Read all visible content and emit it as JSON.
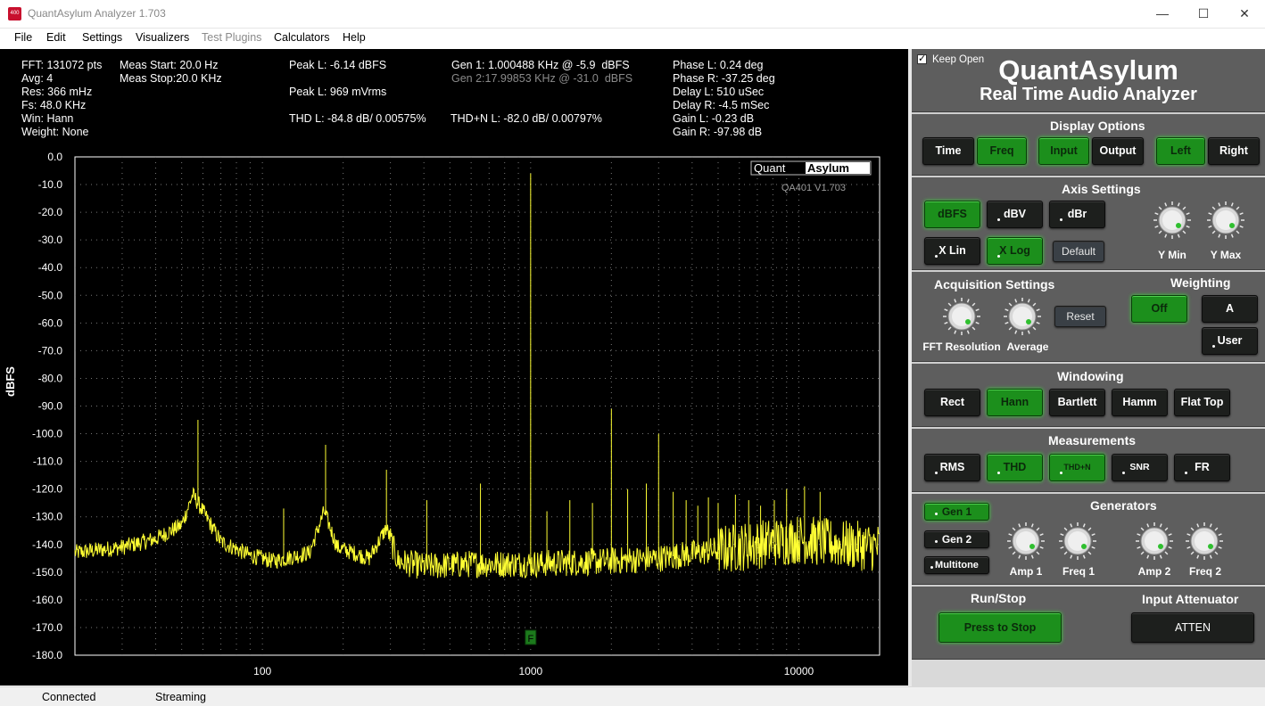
{
  "window": {
    "title": "QuantAsylum Analyzer 1.703",
    "icon_text": "400",
    "minimize": "—",
    "maximize": "☐",
    "close": "✕"
  },
  "menu": [
    "File",
    "Edit",
    "Settings",
    "Visualizers",
    "Test Plugins",
    "Calculators",
    "Help"
  ],
  "stats": {
    "fft": "FFT: 131072 pts",
    "avg": "Avg: 4",
    "res": "Res: 366 mHz",
    "fs": "Fs: 48.0 KHz",
    "win": "Win: Hann",
    "weight": "Weight: None",
    "meas_start": "Meas Start: 20.0 Hz",
    "meas_stop": "Meas Stop:20.0 KHz",
    "peak_l_dbfs": "Peak L: -6.14 dBFS",
    "peak_l_vrms": "Peak L: 969 mVrms",
    "thd_l": "THD L: -84.8 dB/ 0.00575%",
    "gen1": "Gen 1: 1.000488 KHz @ -5.9  dBFS",
    "gen2": "Gen 2:17.99853 KHz @ -31.0  dBFS",
    "thdn_l": "THD+N L: -82.0 dB/ 0.00797%",
    "phase_l": "Phase L: 0.24 deg",
    "phase_r": "Phase R: -37.25 deg",
    "delay_l": "Delay L: 510 uSec",
    "delay_r": "Delay R: -4.5 mSec",
    "gain_l": "Gain L: -0.23 dB",
    "gain_r": "Gain R: -97.98 dB"
  },
  "chart_data": {
    "type": "line",
    "ylabel": "dBFS",
    "xlabel": "",
    "xscale": "log",
    "xlim": [
      20,
      20000
    ],
    "ylim": [
      -180,
      0
    ],
    "yticks": [
      "0.0",
      "-10.0",
      "-20.0",
      "-30.0",
      "-40.0",
      "-50.0",
      "-60.0",
      "-70.0",
      "-80.0",
      "-90.0",
      "-100.0",
      "-110.0",
      "-120.0",
      "-130.0",
      "-140.0",
      "-150.0",
      "-160.0",
      "-170.0",
      "-180.0"
    ],
    "xticks": [
      {
        "value": 100,
        "label": "100"
      },
      {
        "value": 1000,
        "label": "1000"
      },
      {
        "value": 10000,
        "label": "10000"
      }
    ],
    "grid": true,
    "watermark_brand_a": "Quant",
    "watermark_brand_b": "Asylum",
    "watermark_version": "QA401 V1.703",
    "marker_label": "F",
    "marker_x": 1000,
    "series_color": "#ffff33",
    "noise_floor": [
      [
        20,
        -143
      ],
      [
        30,
        -141
      ],
      [
        40,
        -138
      ],
      [
        50,
        -133
      ],
      [
        55,
        -122
      ],
      [
        60,
        -128
      ],
      [
        70,
        -139
      ],
      [
        90,
        -144
      ],
      [
        110,
        -146
      ],
      [
        150,
        -143
      ],
      [
        170,
        -128
      ],
      [
        190,
        -141
      ],
      [
        250,
        -145
      ],
      [
        290,
        -134
      ],
      [
        320,
        -146
      ],
      [
        400,
        -148
      ],
      [
        600,
        -147
      ],
      [
        1000,
        -147
      ],
      [
        2000,
        -146
      ],
      [
        3000,
        -145
      ],
      [
        5000,
        -142
      ],
      [
        7000,
        -140
      ],
      [
        10000,
        -138
      ],
      [
        14000,
        -140
      ],
      [
        20000,
        -141
      ]
    ],
    "peaks": [
      {
        "x": 57.5,
        "y": -95
      },
      {
        "x": 120,
        "y": -127
      },
      {
        "x": 172,
        "y": -104
      },
      {
        "x": 290,
        "y": -113
      },
      {
        "x": 410,
        "y": -124
      },
      {
        "x": 650,
        "y": -118
      },
      {
        "x": 1000,
        "y": -6
      },
      {
        "x": 1150,
        "y": -128
      },
      {
        "x": 1400,
        "y": -124
      },
      {
        "x": 1700,
        "y": -125
      },
      {
        "x": 2000,
        "y": -91
      },
      {
        "x": 2300,
        "y": -120
      },
      {
        "x": 2700,
        "y": -118
      },
      {
        "x": 3000,
        "y": -100
      },
      {
        "x": 3400,
        "y": -121
      },
      {
        "x": 3800,
        "y": -124
      },
      {
        "x": 4200,
        "y": -126
      },
      {
        "x": 4600,
        "y": -123
      },
      {
        "x": 5000,
        "y": -125
      },
      {
        "x": 5800,
        "y": -122
      },
      {
        "x": 6500,
        "y": -124
      },
      {
        "x": 7200,
        "y": -126
      },
      {
        "x": 8100,
        "y": -124
      },
      {
        "x": 9000,
        "y": -120
      },
      {
        "x": 10500,
        "y": -119
      },
      {
        "x": 12000,
        "y": -121
      }
    ]
  },
  "panel": {
    "keep_open": "Keep Open",
    "brand_title": "QuantAsylum",
    "brand_sub": "Real Time Audio Analyzer",
    "display_options": {
      "title": "Display Options",
      "time": "Time",
      "freq": "Freq",
      "input": "Input",
      "output": "Output",
      "left": "Left",
      "right": "Right"
    },
    "axis_settings": {
      "title": "Axis Settings",
      "dbfs": "dBFS",
      "dbv": "dBV",
      "dbr": "dBr",
      "xlin": "X Lin",
      "xlog": "X Log",
      "default": "Default",
      "ymin": "Y Min",
      "ymax": "Y Max"
    },
    "acquisition": {
      "title": "Acquisition Settings",
      "reset": "Reset",
      "fft_res": "FFT Resolution",
      "average": "Average"
    },
    "weighting": {
      "title": "Weighting",
      "off": "Off",
      "a": "A",
      "user": "User"
    },
    "windowing": {
      "title": "Windowing",
      "rect": "Rect",
      "hann": "Hann",
      "bartlett": "Bartlett",
      "hamm": "Hamm",
      "flattop": "Flat Top"
    },
    "measurements": {
      "title": "Measurements",
      "rms": "RMS",
      "thd": "THD",
      "thdn": "THD+N",
      "snr": "SNR",
      "fr": "FR"
    },
    "generators": {
      "title": "Generators",
      "gen1": "Gen 1",
      "gen2": "Gen 2",
      "multitone": "Multitone",
      "amp1": "Amp 1",
      "freq1": "Freq 1",
      "amp2": "Amp 2",
      "freq2": "Freq 2"
    },
    "runstop": {
      "title": "Run/Stop",
      "button": "Press to Stop"
    },
    "attenuator": {
      "title": "Input Attenuator",
      "button": "ATTEN"
    }
  },
  "status": {
    "connected": "Connected",
    "streaming": "Streaming"
  },
  "colors": {
    "on_green": "#1c8f1c",
    "trace_yellow": "#ffff33",
    "panel_gray": "#5e5e5e"
  }
}
